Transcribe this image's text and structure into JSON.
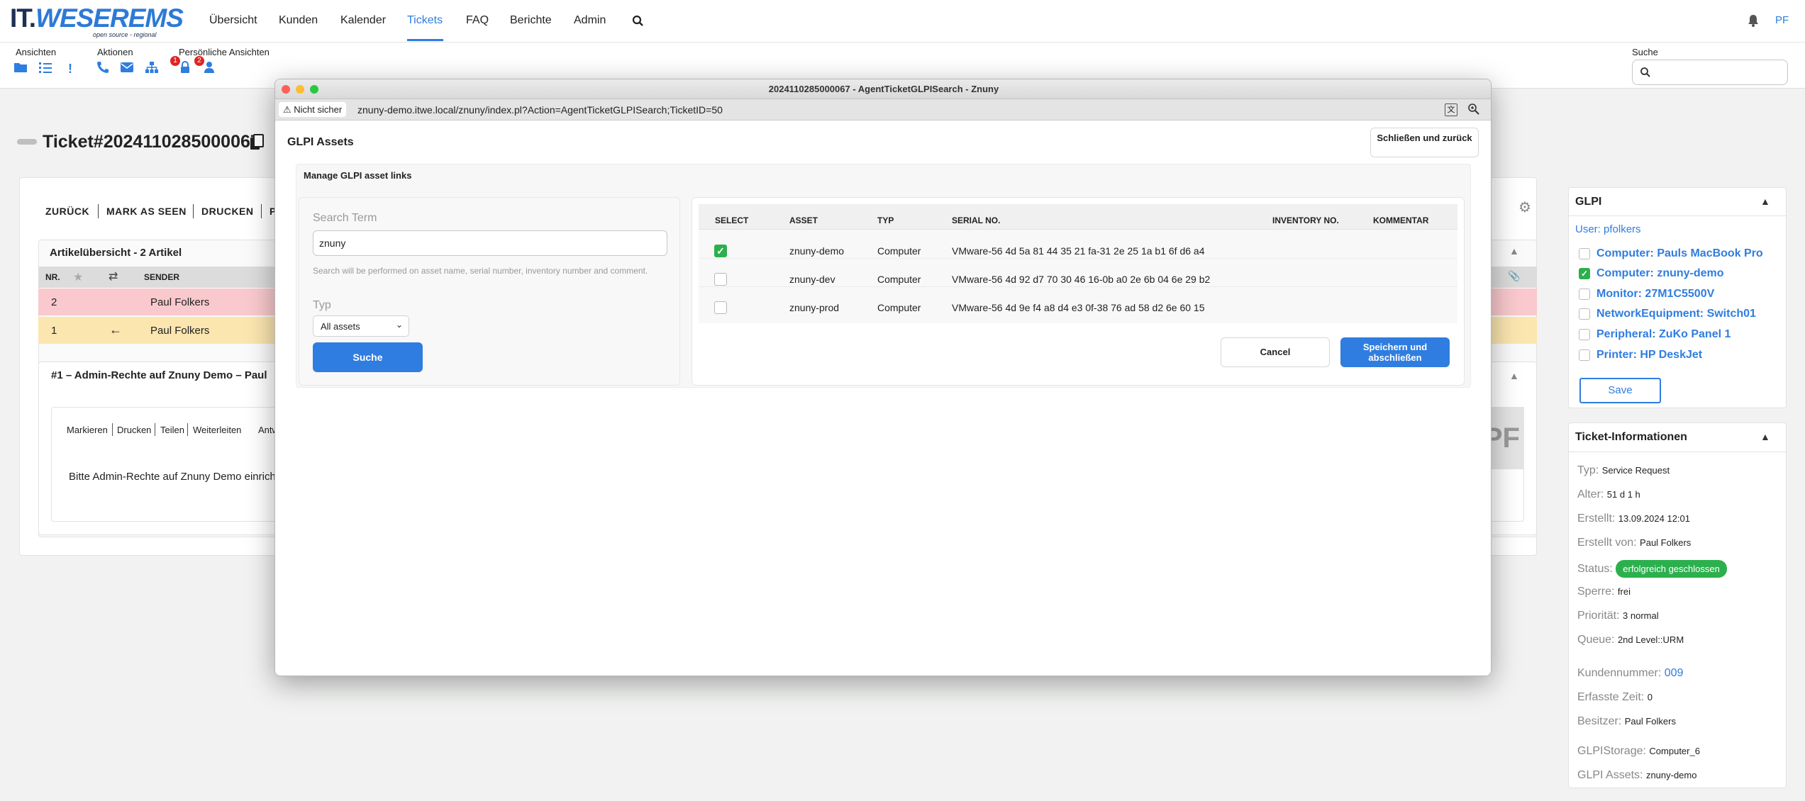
{
  "logo": {
    "brand_left": "IT.",
    "brand_right": "WESEREMS",
    "tagline": "open source - regional"
  },
  "nav": {
    "items": [
      "Übersicht",
      "Kunden",
      "Kalender",
      "Tickets",
      "FAQ",
      "Berichte",
      "Admin"
    ],
    "active": "Tickets",
    "user_initials": "PF",
    "icons": [
      "search-icon",
      "bell-icon"
    ]
  },
  "toolbar": {
    "groups": {
      "ansichten": "Ansichten",
      "aktionen": "Aktionen",
      "persoenliche": "Persönliche Ansichten",
      "suche": "Suche"
    },
    "badges": [
      "1",
      "2"
    ]
  },
  "ticket": {
    "title": "Ticket#2024110285000067"
  },
  "actions": [
    "ZURÜCK",
    "MARK AS SEEN",
    "DRUCKEN",
    "P"
  ],
  "articles": {
    "heading": "Artikelübersicht - 2 Artikel",
    "columns": [
      "NR.",
      "SENDER"
    ],
    "rows": [
      {
        "nr": "2",
        "sender": "Paul Folkers"
      },
      {
        "nr": "1",
        "sender": "Paul Folkers"
      }
    ]
  },
  "article": {
    "heading": "#1 – Admin-Rechte auf Znuny Demo – Paul",
    "actions": [
      "Markieren",
      "Drucken",
      "Teilen",
      "Weiterleiten",
      "Antw"
    ],
    "body": "Bitte Admin-Rechte auf Znuny Demo einrichte",
    "avatar": "PF"
  },
  "window": {
    "title": "2024110285000067 - AgentTicketGLPISearch - Znuny",
    "security": "Nicht sicher",
    "url": "znuny-demo.itwe.local/znuny/index.pl?Action=AgentTicketGLPISearch;TicketID=50",
    "heading": "GLPI Assets",
    "close_label": "Schließen und zurück",
    "section": "Manage GLPI asset links",
    "search": {
      "label": "Search Term",
      "value": "znuny",
      "hint": "Search will be performed on asset name, serial number, inventory number and comment.",
      "type_label": "Typ",
      "type_value": "All assets",
      "button": "Suche"
    },
    "table": {
      "columns": [
        "SELECT",
        "ASSET",
        "TYP",
        "SERIAL NO.",
        "INVENTORY NO.",
        "KOMMENTAR"
      ],
      "rows": [
        {
          "selected": true,
          "asset": "znuny-demo",
          "typ": "Computer",
          "serial": "VMware-56 4d 5a 81 44 35 21 fa-31 2e 25 1a b1 6f d6 a4",
          "inventory": "",
          "comment": ""
        },
        {
          "selected": false,
          "asset": "znuny-dev",
          "typ": "Computer",
          "serial": "VMware-56 4d 92 d7 70 30 46 16-0b a0 2e 6b 04 6e 29 b2",
          "inventory": "",
          "comment": ""
        },
        {
          "selected": false,
          "asset": "znuny-prod",
          "typ": "Computer",
          "serial": "VMware-56 4d 9e f4 a8 d4 e3 0f-38 76 ad 58 d2 6e 60 15",
          "inventory": "",
          "comment": ""
        }
      ]
    },
    "cancel": "Cancel",
    "save": "Speichern und abschließen"
  },
  "glpi": {
    "heading": "GLPI",
    "user": "User: pfolkers",
    "items": [
      {
        "label": "Computer: Pauls MacBook Pro",
        "checked": false
      },
      {
        "label": "Computer: znuny-demo",
        "checked": true
      },
      {
        "label": "Monitor: 27M1C5500V",
        "checked": false
      },
      {
        "label": "NetworkEquipment: Switch01",
        "checked": false
      },
      {
        "label": "Peripheral: ZuKo Panel 1",
        "checked": false
      },
      {
        "label": "Printer: HP DeskJet",
        "checked": false
      }
    ],
    "save": "Save"
  },
  "info": {
    "heading": "Ticket-Informationen",
    "fields": [
      {
        "k": "Typ:",
        "v": "Service Request"
      },
      {
        "k": "Alter:",
        "v": "51 d 1 h"
      },
      {
        "k": "Erstellt:",
        "v": "13.09.2024 12:01"
      },
      {
        "k": "Erstellt von:",
        "v": "Paul Folkers"
      },
      {
        "k": "Status:",
        "v": "erfolgreich geschlossen"
      },
      {
        "k": "Sperre:",
        "v": "frei"
      },
      {
        "k": "Priorität:",
        "v": "3 normal"
      },
      {
        "k": "Queue:",
        "v": "2nd Level::URM"
      },
      {
        "k": "Kundennummer:",
        "v": "009"
      },
      {
        "k": "Erfasste Zeit:",
        "v": "0"
      },
      {
        "k": "Besitzer:",
        "v": "Paul Folkers"
      },
      {
        "k": "GLPIStorage:",
        "v": "Computer_6"
      },
      {
        "k": "GLPI Assets:",
        "v": "znuny-demo"
      }
    ]
  },
  "colors": {
    "accent": "#2f7de0",
    "success": "#2cb04e",
    "row_red": "#f9c9cd",
    "row_yellow": "#fbe6b0"
  }
}
